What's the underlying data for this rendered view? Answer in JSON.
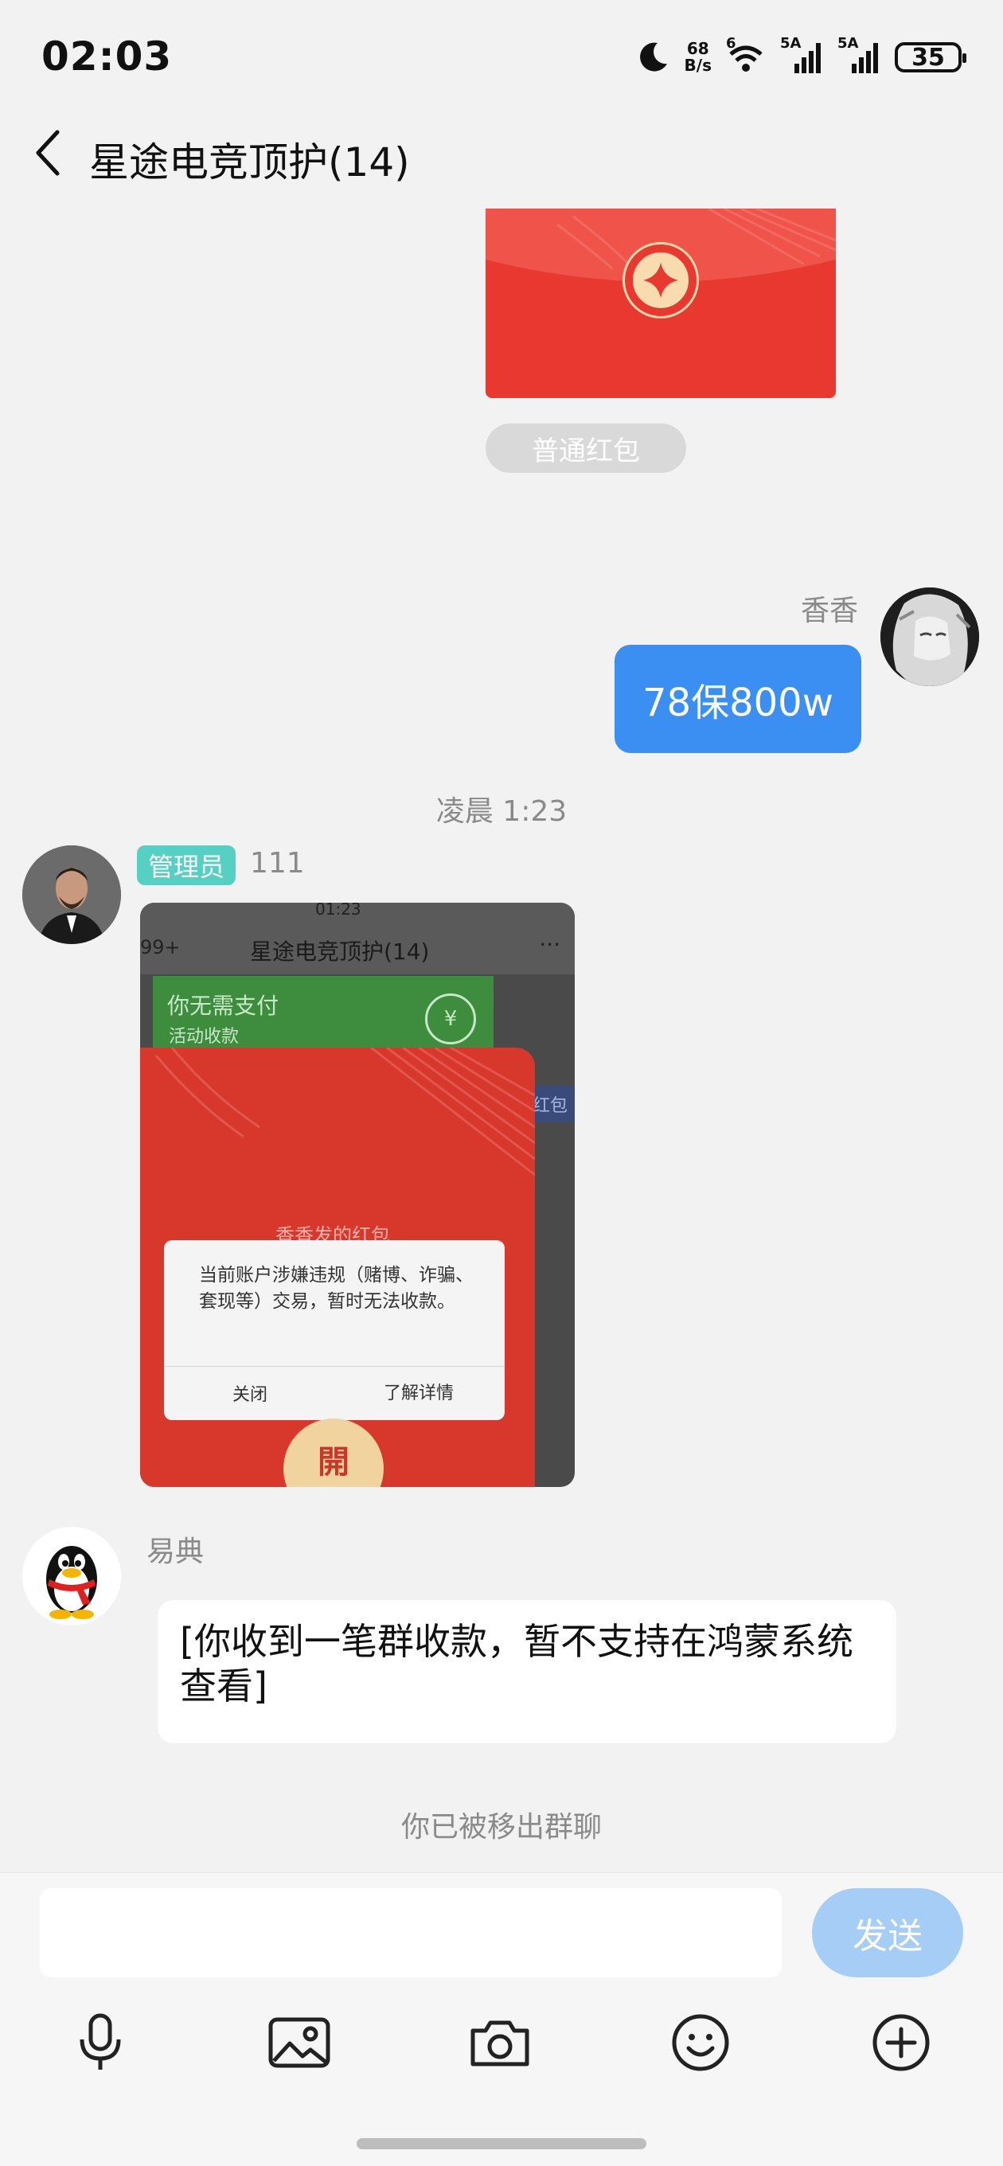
{
  "status_bar": {
    "time": "02:03",
    "net_speed_top": "68",
    "net_speed_bottom": "B/s",
    "wifi_label": "6",
    "signal1_label": "5A",
    "signal2_label": "5A",
    "battery": "35"
  },
  "header": {
    "title": "星途电竞顶护(14)"
  },
  "red_packet": {
    "label": "普通红包"
  },
  "message_xiangxiang": {
    "sender": "香香",
    "text": "78保800w"
  },
  "timestamp": "凌晨 1:23",
  "message_admin": {
    "badge": "管理员",
    "sender": "111",
    "screenshot": {
      "status_time": "01:23",
      "unread_badge": "99+",
      "title": "星途电竞顶护(14)",
      "more": "···",
      "green_title": "你无需支付",
      "green_sub": "活动收款",
      "side_label": "红包",
      "red_sender": "香香发的红包",
      "dialog_text": "当前账户涉嫌违规（赌博、诈骗、套现等）交易，暂时无法收款。",
      "dialog_close": "关闭",
      "dialog_more": "了解详情",
      "open_label": "開"
    }
  },
  "message_yidian": {
    "sender": "易典",
    "text": "[你收到一笔群收款，暂不支持在鸿蒙系统查看]"
  },
  "system_note": "你已被移出群聊",
  "composer": {
    "input_value": "",
    "send_label": "发送"
  },
  "icons": {
    "back": "chevron-left-icon",
    "mic": "microphone-icon",
    "image": "image-icon",
    "camera": "camera-icon",
    "emoji": "emoji-icon",
    "plus": "plus-circle-icon"
  },
  "colors": {
    "bubble_blue": "#3b8ff2",
    "red_packet": "#e8382f",
    "admin_badge": "#56d0c2",
    "send_button": "#a6cdf6"
  }
}
